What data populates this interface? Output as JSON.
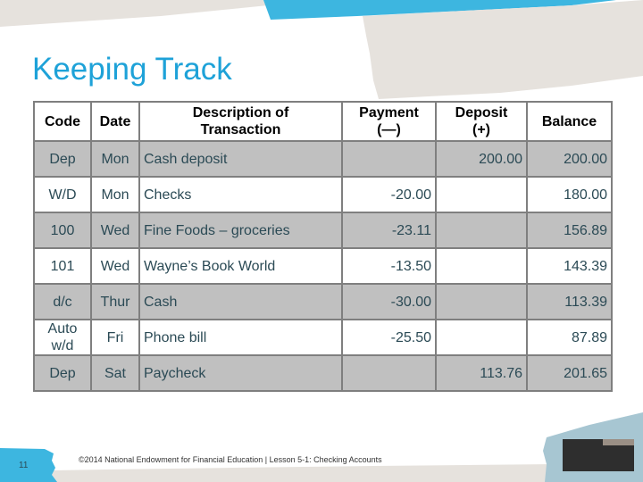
{
  "slide": {
    "title": "Keeping Track",
    "page_number": "11",
    "footer": "©2014 National Endowment for Financial Education | Lesson 5-1: Checking Accounts",
    "colors": {
      "title": "#1ea2d8",
      "accent_tape": "#3db6e0",
      "paper_tape": "#e6e2dd",
      "row_shade": "#c0c0c0",
      "cell_text": "#2b4a55",
      "border": "#7f7f7f"
    }
  },
  "table": {
    "headers": {
      "code": "Code",
      "date": "Date",
      "description": "Description of Transaction",
      "payment": "Payment (—)",
      "deposit": "Deposit (+)",
      "balance": "Balance"
    },
    "rows": [
      {
        "code": "Dep",
        "date": "Mon",
        "description": "Cash deposit",
        "payment": "",
        "deposit": "200.00",
        "balance": "200.00"
      },
      {
        "code": "W/D",
        "date": "Mon",
        "description": "Checks",
        "payment": "-20.00",
        "deposit": "",
        "balance": "180.00"
      },
      {
        "code": "100",
        "date": "Wed",
        "description": "Fine Foods – groceries",
        "payment": "-23.11",
        "deposit": "",
        "balance": "156.89"
      },
      {
        "code": "101",
        "date": "Wed",
        "description": "Wayne’s Book World",
        "payment": "-13.50",
        "deposit": "",
        "balance": "143.39"
      },
      {
        "code": "d/c",
        "date": "Thur",
        "description": "Cash",
        "payment": "-30.00",
        "deposit": "",
        "balance": "113.39"
      },
      {
        "code": "Auto w/d",
        "date": "Fri",
        "description": "Phone bill",
        "payment": "-25.50",
        "deposit": "",
        "balance": "87.89"
      },
      {
        "code": "Dep",
        "date": "Sat",
        "description": "Paycheck",
        "payment": "",
        "deposit": "113.76",
        "balance": "201.65"
      }
    ]
  }
}
